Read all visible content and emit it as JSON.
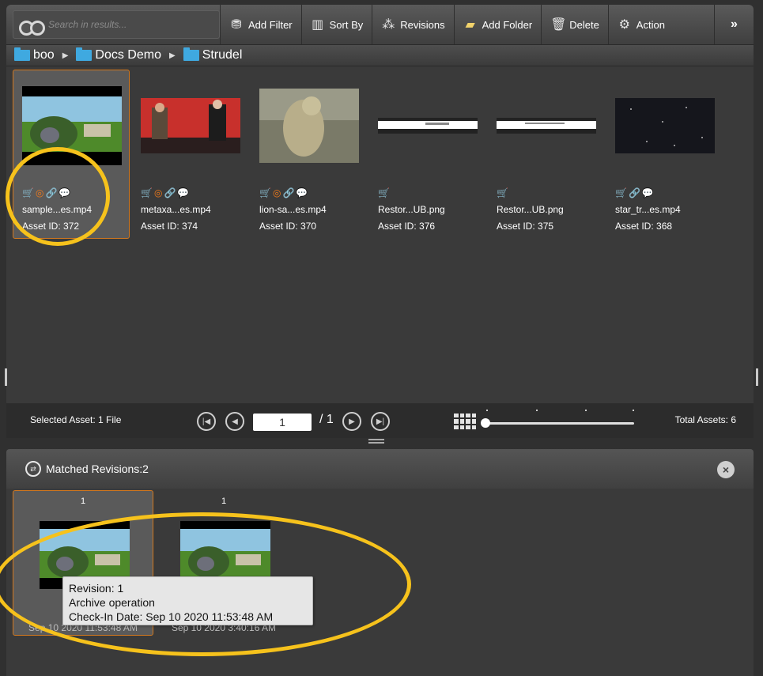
{
  "toolbar": {
    "search_placeholder": "Search in results...",
    "buttons": [
      {
        "label": "Add Filter",
        "icon": "filter-icon"
      },
      {
        "label": "Sort By",
        "icon": "sort-icon"
      },
      {
        "label": "Revisions",
        "icon": "revisions-icon"
      },
      {
        "label": "Add Folder",
        "icon": "add-folder-icon"
      },
      {
        "label": "Delete",
        "icon": "trash-icon"
      },
      {
        "label": "Action",
        "icon": "gear-icon"
      }
    ],
    "more_label": "»"
  },
  "breadcrumb": [
    "boo",
    "Docs Demo",
    "Strudel"
  ],
  "assets": [
    {
      "name": "sample...es.mp4",
      "asset_id": "Asset ID: 372",
      "selected": true,
      "icons": [
        "cart",
        "ring",
        "link",
        "chat"
      ]
    },
    {
      "name": "metaxa...es.mp4",
      "asset_id": "Asset ID: 374",
      "selected": false,
      "icons": [
        "cart",
        "ring",
        "link",
        "chat"
      ]
    },
    {
      "name": "lion-sa...es.mp4",
      "asset_id": "Asset ID: 370",
      "selected": false,
      "icons": [
        "cart",
        "ring",
        "link",
        "chat"
      ]
    },
    {
      "name": "Restor...UB.png",
      "asset_id": "Asset ID: 376",
      "selected": false,
      "icons": [
        "cart"
      ]
    },
    {
      "name": "Restor...UB.png",
      "asset_id": "Asset ID: 375",
      "selected": false,
      "icons": [
        "cart"
      ]
    },
    {
      "name": "star_tr...es.mp4",
      "asset_id": "Asset ID: 368",
      "selected": false,
      "icons": [
        "cart",
        "link",
        "chat"
      ]
    }
  ],
  "pager": {
    "selected_text": "Selected Asset: 1 File",
    "current_page": "1",
    "total_pages": "/ 1",
    "total_assets": "Total Assets: 6"
  },
  "revisions": {
    "title": "Matched Revisions:2",
    "close_label": "×",
    "items": [
      {
        "number": "1",
        "date": "Sep 10 2020 11:53:48 AM",
        "selected": true
      },
      {
        "number": "1",
        "date": "Sep 10 2020 3:40:16 AM",
        "selected": false
      }
    ],
    "tooltip": {
      "line1": "Revision: 1",
      "line2": "Archive operation",
      "line3": "Check-In Date: Sep 10 2020 11:53:48 AM"
    }
  },
  "colors": {
    "accent": "#d2781e",
    "annotation": "#f6c21c",
    "folder": "#3fa9e0"
  }
}
